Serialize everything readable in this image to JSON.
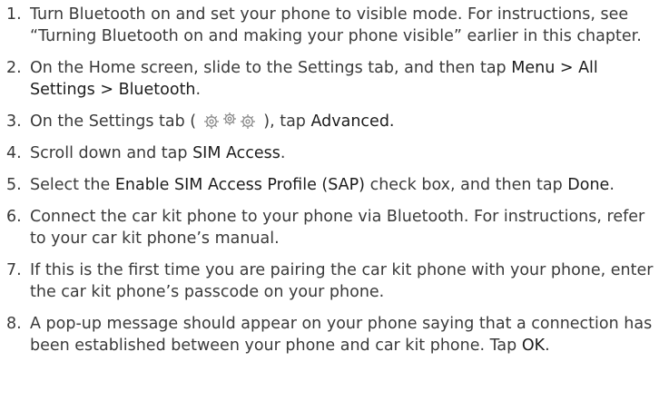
{
  "steps": [
    {
      "num": "1.",
      "parts": [
        {
          "t": "Turn Bluetooth on and set your phone to visible mode. For instructions, see “Turning Bluetooth on and making your phone visible” earlier in this chapter."
        }
      ]
    },
    {
      "num": "2.",
      "parts": [
        {
          "t": "On the Home screen, slide to the Settings tab, and then tap "
        },
        {
          "t": "Menu > All Settings > Bluetooth",
          "hl": true
        },
        {
          "t": "."
        }
      ]
    },
    {
      "num": "3.",
      "parts": [
        {
          "t": "On the Settings tab ( "
        },
        {
          "icon": "settings-gears-icon"
        },
        {
          "t": " ), tap "
        },
        {
          "t": "Advanced.",
          "hl": true
        }
      ]
    },
    {
      "num": "4.",
      "parts": [
        {
          "t": "Scroll down and tap "
        },
        {
          "t": "SIM Access",
          "hl": true
        },
        {
          "t": "."
        }
      ]
    },
    {
      "num": "5.",
      "parts": [
        {
          "t": "Select the "
        },
        {
          "t": "Enable SIM Access Profile (SAP)",
          "hl": true
        },
        {
          "t": " check box, and then tap "
        },
        {
          "t": "Done",
          "hl": true
        },
        {
          "t": "."
        }
      ]
    },
    {
      "num": "6.",
      "parts": [
        {
          "t": "Connect the car kit phone to your phone via Bluetooth. For instructions, refer to your car kit phone’s manual."
        }
      ]
    },
    {
      "num": "7.",
      "parts": [
        {
          "t": "If this is the first time you are pairing the car kit phone with your phone, enter the car kit phone’s passcode on your phone."
        }
      ]
    },
    {
      "num": "8.",
      "parts": [
        {
          "t": "A pop-up message should appear on your phone saying that a connection has been established between your phone and car kit phone. Tap "
        },
        {
          "t": "OK",
          "hl": true
        },
        {
          "t": "."
        }
      ]
    }
  ]
}
